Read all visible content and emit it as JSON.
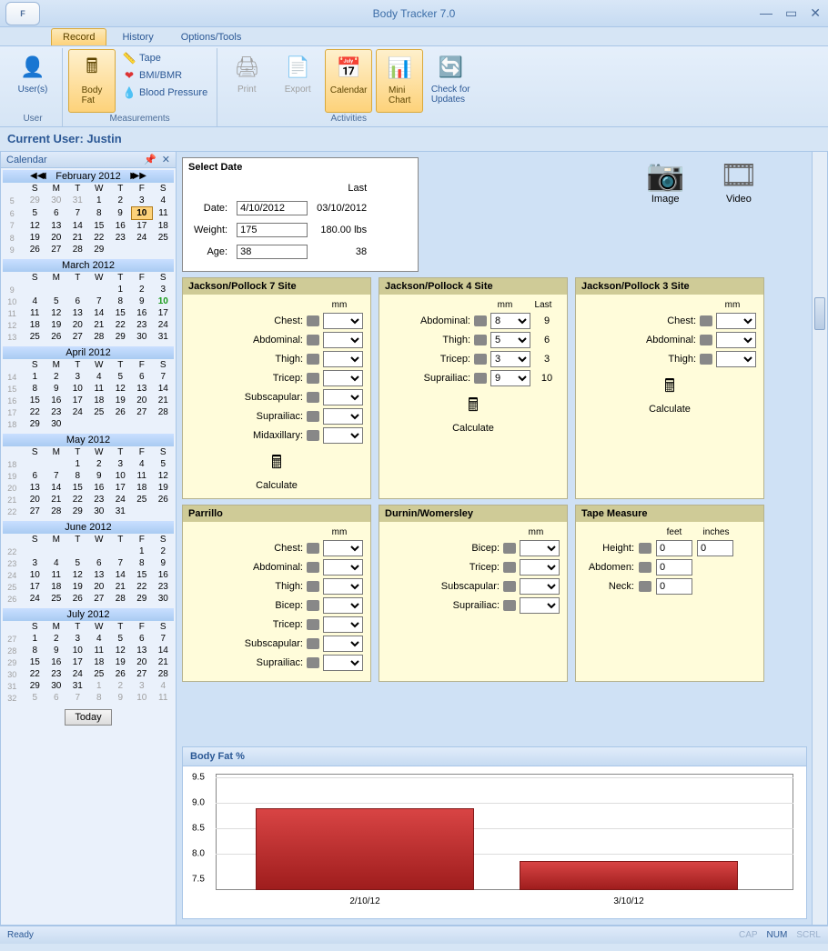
{
  "app": {
    "title": "Body Tracker 7.0"
  },
  "ribbon_tabs": {
    "record": "Record",
    "history": "History",
    "options": "Options/Tools"
  },
  "ribbon": {
    "user_group": "User",
    "users_btn": "User(s)",
    "measurements_group": "Measurements",
    "bodyfat_btn": "Body\nFat",
    "tape_btn": "Tape",
    "bmi_btn": "BMI/BMR",
    "bp_btn": "Blood Pressure",
    "activities_group": "Activities",
    "print_btn": "Print",
    "export_btn": "Export",
    "calendar_btn": "Calendar",
    "minichart_btn": "Mini\nChart",
    "updates_btn": "Check for\nUpdates"
  },
  "userbar": "Current User: Justin",
  "sidebar": {
    "title": "Calendar",
    "months": {
      "feb": "February 2012",
      "mar": "March 2012",
      "apr": "April 2012",
      "may": "May 2012",
      "jun": "June 2012",
      "jul": "July 2012"
    },
    "dow": [
      "S",
      "M",
      "T",
      "W",
      "T",
      "F",
      "S"
    ],
    "today_btn": "Today"
  },
  "selectdate": {
    "title": "Select Date",
    "last_label": "Last",
    "date_label": "Date:",
    "date_value": "4/10/2012",
    "date_last": "03/10/2012",
    "weight_label": "Weight:",
    "weight_value": "175",
    "weight_last": "180.00 lbs",
    "age_label": "Age:",
    "age_value": "38",
    "age_last": "38"
  },
  "media": {
    "image": "Image",
    "video": "Video"
  },
  "jp7": {
    "title": "Jackson/Pollock 7 Site",
    "unit": "mm",
    "fields": [
      "Chest:",
      "Abdominal:",
      "Thigh:",
      "Tricep:",
      "Subscapular:",
      "Suprailiac:",
      "Midaxillary:"
    ],
    "calc": "Calculate"
  },
  "jp4": {
    "title": "Jackson/Pollock 4 Site",
    "unit": "mm",
    "last": "Last",
    "rows": [
      {
        "label": "Abdominal:",
        "val": "8",
        "last": "9"
      },
      {
        "label": "Thigh:",
        "val": "5",
        "last": "6"
      },
      {
        "label": "Tricep:",
        "val": "3",
        "last": "3"
      },
      {
        "label": "Suprailiac:",
        "val": "9",
        "last": "10"
      }
    ],
    "calc": "Calculate"
  },
  "jp3": {
    "title": "Jackson/Pollock 3 Site",
    "unit": "mm",
    "fields": [
      "Chest:",
      "Abdominal:",
      "Thigh:"
    ],
    "calc": "Calculate"
  },
  "parrillo": {
    "title": "Parrillo",
    "unit": "mm",
    "fields": [
      "Chest:",
      "Abdominal:",
      "Thigh:",
      "Bicep:",
      "Tricep:",
      "Subscapular:",
      "Suprailiac:"
    ]
  },
  "durnin": {
    "title": "Durnin/Womersley",
    "unit": "mm",
    "fields": [
      "Bicep:",
      "Tricep:",
      "Subscapular:",
      "Suprailiac:"
    ]
  },
  "tape": {
    "title": "Tape Measure",
    "feet": "feet",
    "inches": "inches",
    "rows": [
      {
        "label": "Height:",
        "v1": "0",
        "v2": "0"
      },
      {
        "label": "Abdomen:",
        "v1": "0"
      },
      {
        "label": "Neck:",
        "v1": "0"
      }
    ]
  },
  "chart": {
    "title": "Body Fat %"
  },
  "chart_data": {
    "type": "bar",
    "categories": [
      "2/10/12",
      "3/10/12"
    ],
    "values": [
      9.1,
      8.05
    ],
    "title": "Body Fat %",
    "xlabel": "",
    "ylabel": "",
    "ylim": [
      7.5,
      9.5
    ],
    "yticks": [
      7.5,
      8.0,
      8.5,
      9.0,
      9.5
    ]
  },
  "status": {
    "ready": "Ready",
    "cap": "CAP",
    "num": "NUM",
    "scrl": "SCRL"
  }
}
